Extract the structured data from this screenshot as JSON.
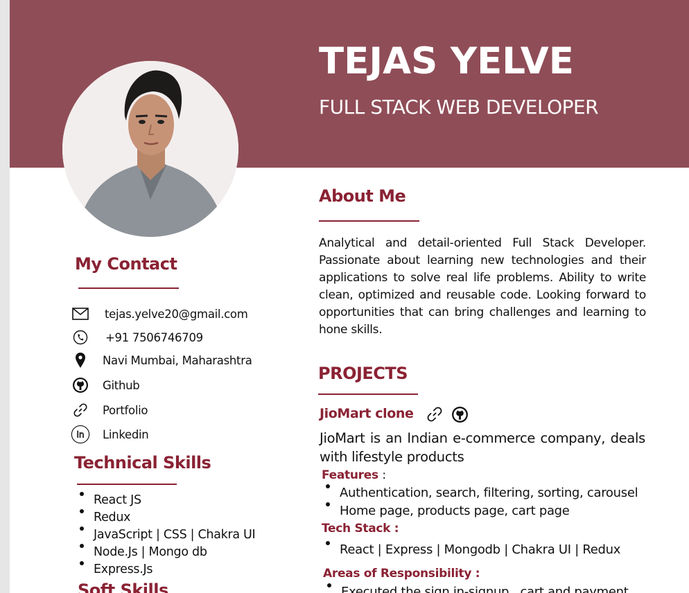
{
  "header": {
    "name": "TEJAS YELVE",
    "role": "FULL STACK WEB DEVELOPER"
  },
  "colors": {
    "header_band": "#8f4d57",
    "accent": "#8a2233",
    "page_bg": "#ffffff"
  },
  "contact": {
    "title": "My Contact",
    "items": [
      {
        "icon": "mail-icon",
        "text": "tejas.yelve20@gmail.com"
      },
      {
        "icon": "phone-icon",
        "text": "+91 7506746709"
      },
      {
        "icon": "location-pin-icon",
        "text": "Navi Mumbai, Maharashtra"
      },
      {
        "icon": "github-icon",
        "text": "Github"
      },
      {
        "icon": "link-icon",
        "text": "Portfolio"
      },
      {
        "icon": "linkedin-icon",
        "text": "Linkedin"
      }
    ]
  },
  "technical_skills": {
    "title": "Technical Skills",
    "items": [
      "React JS",
      "Redux",
      "JavaScript | CSS | Chakra UI",
      "Node.Js | Mongo db",
      "Express.Js"
    ]
  },
  "soft_skills": {
    "title": "Soft Skills"
  },
  "about": {
    "title": "About Me",
    "text": "Analytical and detail-oriented Full Stack Developer. Passionate about learning new technologies and their applications to solve real life problems. Ability to write clean, optimized and reusable code. Looking forward to opportunities that can bring challenges and learning to hone  skills."
  },
  "projects": {
    "title": "PROJECTS",
    "items": [
      {
        "name": "JioMart clone",
        "description": "JioMart is an Indian e-commerce company, deals with lifestyle products",
        "features_label": "Features",
        "features": [
          "Authentication, search, filtering, sorting, carousel",
          "Home page, products page, cart page"
        ],
        "tech_stack_label": "Tech Stack :",
        "tech_stack": [
          "React | Express | Mongodb | Chakra UI | Redux"
        ],
        "responsibility_label": "Areas of Responsibility :",
        "responsibilities": [
          "Executed the sign in-signup , cart and payment"
        ]
      }
    ]
  }
}
